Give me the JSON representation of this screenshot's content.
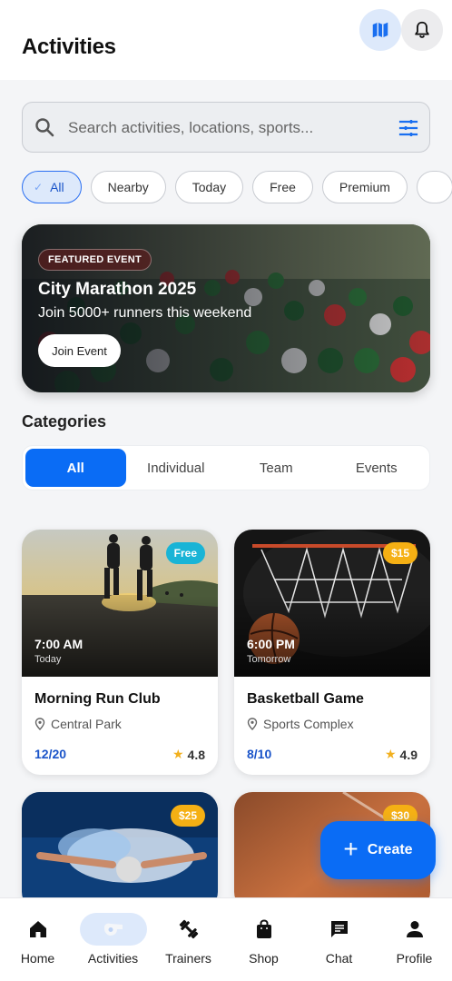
{
  "header": {
    "title": "Activities",
    "map_icon": "map-icon",
    "notification_icon": "bell-icon"
  },
  "search": {
    "placeholder": "Search activities, locations, sports...",
    "value": "",
    "filter_icon": "tune-icon"
  },
  "filter_chips": [
    {
      "label": "All",
      "selected": true
    },
    {
      "label": "Nearby",
      "selected": false
    },
    {
      "label": "Today",
      "selected": false
    },
    {
      "label": "Free",
      "selected": false
    },
    {
      "label": "Premium",
      "selected": false
    }
  ],
  "featured": {
    "badge": "FEATURED EVENT",
    "title": "City Marathon 2025",
    "subtitle": "Join 5000+ runners this weekend",
    "button": "Join Event"
  },
  "categories": {
    "title": "Categories",
    "tabs": [
      {
        "label": "All",
        "selected": true
      },
      {
        "label": "Individual",
        "selected": false
      },
      {
        "label": "Team",
        "selected": false
      },
      {
        "label": "Events",
        "selected": false
      }
    ]
  },
  "activities": [
    {
      "name": "Morning Run Club",
      "time": "7:00 AM",
      "when": "Today",
      "location": "Central Park",
      "spots": "12/20",
      "rating": "4.8",
      "price": "Free",
      "price_color": "#19b4d6"
    },
    {
      "name": "Basketball Game",
      "time": "6:00 PM",
      "when": "Tomorrow",
      "location": "Sports Complex",
      "spots": "8/10",
      "rating": "4.9",
      "price": "$15",
      "price_color": "#f5b014"
    },
    {
      "price": "$25",
      "price_color": "#f5b014"
    },
    {
      "price": "$30",
      "price_color": "#f5b014"
    }
  ],
  "fab": {
    "label": "Create",
    "icon": "plus-icon"
  },
  "bottom_nav": [
    {
      "label": "Home",
      "icon": "home-icon",
      "active": false
    },
    {
      "label": "Activities",
      "icon": "whistle-icon",
      "active": true
    },
    {
      "label": "Trainers",
      "icon": "dumbbell-icon",
      "active": false
    },
    {
      "label": "Shop",
      "icon": "shopping-bag-icon",
      "active": false
    },
    {
      "label": "Chat",
      "icon": "chat-icon",
      "active": false
    },
    {
      "label": "Profile",
      "icon": "person-icon",
      "active": false
    }
  ],
  "colors": {
    "accent": "#0a6cf5",
    "accent_light": "#dde9fb",
    "rating_star": "#f2b01e"
  }
}
